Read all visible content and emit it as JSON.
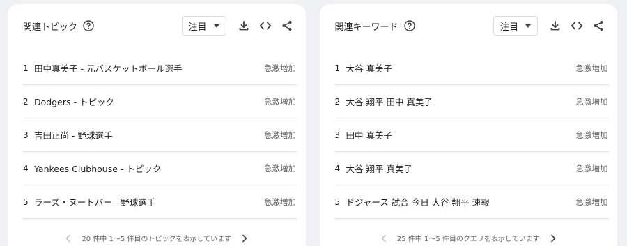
{
  "panels": [
    {
      "title": "関連トピック",
      "sort_label": "注目",
      "rows": [
        {
          "rank": "1",
          "name": "田中真美子 - 元バスケットボール選手",
          "value": "急激増加"
        },
        {
          "rank": "2",
          "name": "Dodgers - トピック",
          "value": "急激増加"
        },
        {
          "rank": "3",
          "name": "吉田正尚 - 野球選手",
          "value": "急激増加"
        },
        {
          "rank": "4",
          "name": "Yankees Clubhouse - トピック",
          "value": "急激増加"
        },
        {
          "rank": "5",
          "name": "ラーズ・ヌートバー - 野球選手",
          "value": "急激増加"
        }
      ],
      "pagination": "20 件中 1〜5 件目のトピックを表示しています"
    },
    {
      "title": "関連キーワード",
      "sort_label": "注目",
      "rows": [
        {
          "rank": "1",
          "name": "大谷 真美子",
          "value": "急激増加"
        },
        {
          "rank": "2",
          "name": "大谷 翔平 田中 真美子",
          "value": "急激増加"
        },
        {
          "rank": "3",
          "name": "田中 真美子",
          "value": "急激増加"
        },
        {
          "rank": "4",
          "name": "大谷 翔平 真美子",
          "value": "急激増加"
        },
        {
          "rank": "5",
          "name": "ドジャース 試合 今日 大谷 翔平 速報",
          "value": "急激増加"
        }
      ],
      "pagination": "25 件中 1〜5 件目のクエリを表示しています"
    }
  ],
  "icons": {
    "help": "help-circle-icon",
    "download": "download-icon",
    "embed": "code-embed-icon",
    "share": "share-icon",
    "prev": "chevron-left-icon",
    "next": "chevron-right-icon"
  },
  "colors": {
    "background": "#eef0f3",
    "card": "#ffffff",
    "divider": "#e0e0e0",
    "muted_text": "#5f6368"
  }
}
